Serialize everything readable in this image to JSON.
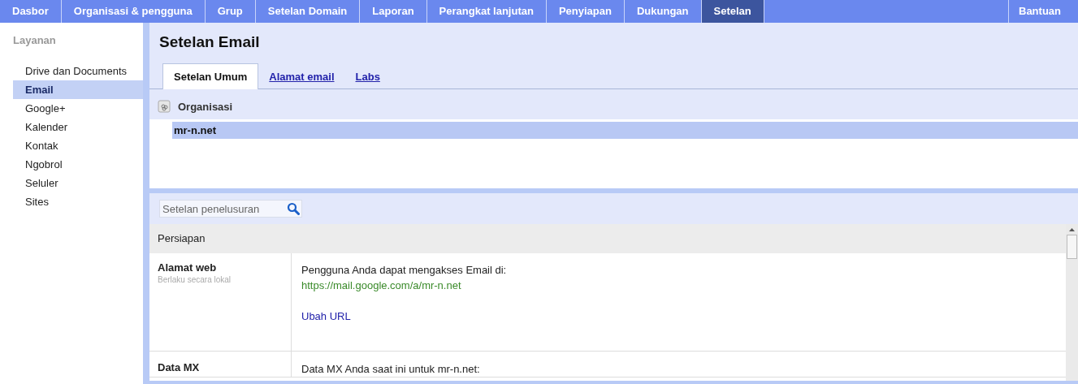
{
  "top_nav": {
    "items": [
      {
        "label": "Dasbor",
        "selected": false
      },
      {
        "label": "Organisasi & pengguna",
        "selected": false
      },
      {
        "label": "Grup",
        "selected": false
      },
      {
        "label": "Setelan Domain",
        "selected": false
      },
      {
        "label": "Laporan",
        "selected": false
      },
      {
        "label": "Perangkat lanjutan",
        "selected": false
      },
      {
        "label": "Penyiapan",
        "selected": false
      },
      {
        "label": "Dukungan",
        "selected": false
      },
      {
        "label": "Setelan",
        "selected": true
      }
    ],
    "help": "Bantuan"
  },
  "sidebar": {
    "heading": "Layanan",
    "items": [
      {
        "label": "Drive dan Documents",
        "selected": false
      },
      {
        "label": "Email",
        "selected": true
      },
      {
        "label": "Google+",
        "selected": false
      },
      {
        "label": "Kalender",
        "selected": false
      },
      {
        "label": "Kontak",
        "selected": false
      },
      {
        "label": "Ngobrol",
        "selected": false
      },
      {
        "label": "Seluler",
        "selected": false
      },
      {
        "label": "Sites",
        "selected": false
      }
    ]
  },
  "page_title": "Setelan Email",
  "tabs": [
    {
      "label": "Setelan Umum",
      "selected": true
    },
    {
      "label": "Alamat email",
      "selected": false
    },
    {
      "label": "Labs",
      "selected": false
    }
  ],
  "org_tree": {
    "heading": "Organisasi",
    "items": [
      {
        "label": "mr-n.net",
        "selected": true
      }
    ]
  },
  "search": {
    "placeholder": "Setelan penelusuran"
  },
  "section": {
    "title": "Persiapan",
    "rows": [
      {
        "label": "Alamat web",
        "note": "Berlaku secara lokal",
        "text": "Pengguna Anda dapat mengakses Email di:",
        "url": "https://mail.google.com/a/mr-n.net",
        "link": "Ubah URL"
      },
      {
        "label": "Data MX",
        "text": "Data MX Anda saat ini untuk mr-n.net:"
      }
    ]
  }
}
